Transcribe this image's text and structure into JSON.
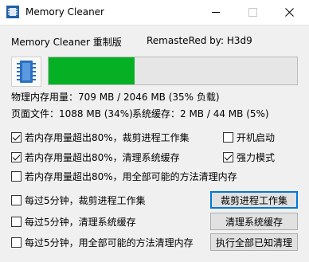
{
  "window": {
    "title": "Memory Cleaner"
  },
  "header": {
    "app_name": "Memory Cleaner 重制版",
    "credit": "RemasteRed by: H3d9"
  },
  "memory": {
    "usage_fraction": 0.347,
    "physical_line": "物理内存用量：709 MB  /  2046 MB  (35% 负载)",
    "page_file_line": "页面文件：1088 MB  (34%)",
    "system_cache_line": "系统缓存：2 MB / 44 MB  (5%)"
  },
  "options": {
    "trim_over80": {
      "label": "若内存用量超出80%，裁剪进程工作集",
      "checked": true
    },
    "clean_cache_over80": {
      "label": "若内存用量超出80%，清理系统缓存",
      "checked": true
    },
    "all_over80": {
      "label": "若内存用量超出80%，用全部可能的方法清理内存",
      "checked": false
    },
    "autostart": {
      "label": "开机启动",
      "checked": false
    },
    "force_mode": {
      "label": "强力模式",
      "checked": true
    },
    "trim_5min": {
      "label": "每过5分钟，裁剪进程工作集",
      "checked": false
    },
    "clean_cache_5min": {
      "label": "每过5分钟，清理系统缓存",
      "checked": false
    },
    "all_5min": {
      "label": "每过5分钟，用全部可能的方法清理内存",
      "checked": false
    }
  },
  "buttons": {
    "trim_now": "裁剪进程工作集",
    "clean_cache_now": "清理系统缓存",
    "clean_all_now": "执行全部已知清理"
  },
  "colors": {
    "progress": "#06b025",
    "focus_border": "#0078d7"
  }
}
